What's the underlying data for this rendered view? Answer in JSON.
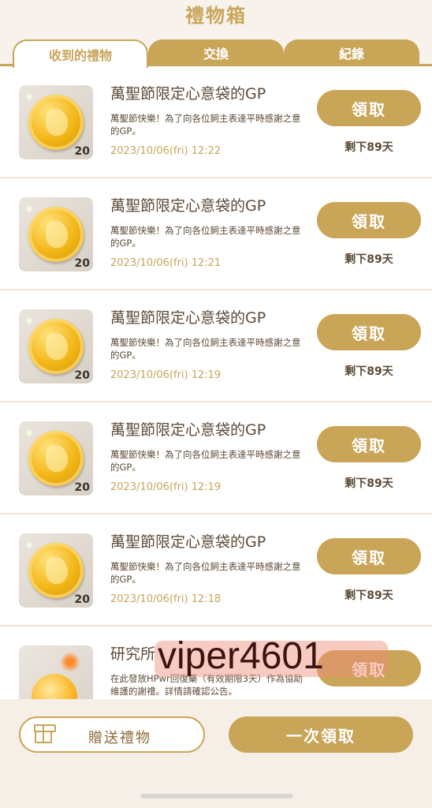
{
  "header": {
    "title": "禮物箱"
  },
  "tabs": [
    {
      "label": "收到的禮物",
      "active": true
    },
    {
      "label": "交換",
      "active": false
    },
    {
      "label": "紀錄",
      "active": false
    }
  ],
  "gifts": [
    {
      "name": "萬聖節限定心意袋的GP",
      "desc": "萬聖節快樂！為了向各位飼主表達平時感謝之意的GP。",
      "date": "2023/10/06(fri) 12:22",
      "qty": "20",
      "claim": "領取",
      "remain": "剩下89天"
    },
    {
      "name": "萬聖節限定心意袋的GP",
      "desc": "萬聖節快樂！為了向各位飼主表達平時感謝之意的GP。",
      "date": "2023/10/06(fri) 12:21",
      "qty": "20",
      "claim": "領取",
      "remain": "剩下89天"
    },
    {
      "name": "萬聖節限定心意袋的GP",
      "desc": "萬聖節快樂！為了向各位飼主表達平時感謝之意的GP。",
      "date": "2023/10/06(fri) 12:19",
      "qty": "20",
      "claim": "領取",
      "remain": "剩下89天"
    },
    {
      "name": "萬聖節限定心意袋的GP",
      "desc": "萬聖節快樂！為了向各位飼主表達平時感謝之意的GP。",
      "date": "2023/10/06(fri) 12:19",
      "qty": "20",
      "claim": "領取",
      "remain": "剩下89天"
    },
    {
      "name": "萬聖節限定心意袋的GP",
      "desc": "萬聖節快樂！為了向各位飼主表達平時感謝之意的GP。",
      "date": "2023/10/06(fri) 12:18",
      "qty": "20",
      "claim": "領取",
      "remain": "剩下89天"
    },
    {
      "name": "研究所",
      "desc": "在此發放HPwr回復藥（有效期限3天）作為協助維護的謝禮。詳情請確認公告。",
      "claim": "領取"
    }
  ],
  "watermark": "viper4601",
  "footer": {
    "send_label": "贈送禮物",
    "claim_all_label": "一次領取"
  },
  "colors": {
    "accent": "#c9a558",
    "text": "#5c4a37",
    "background": "#f7f2ec"
  }
}
